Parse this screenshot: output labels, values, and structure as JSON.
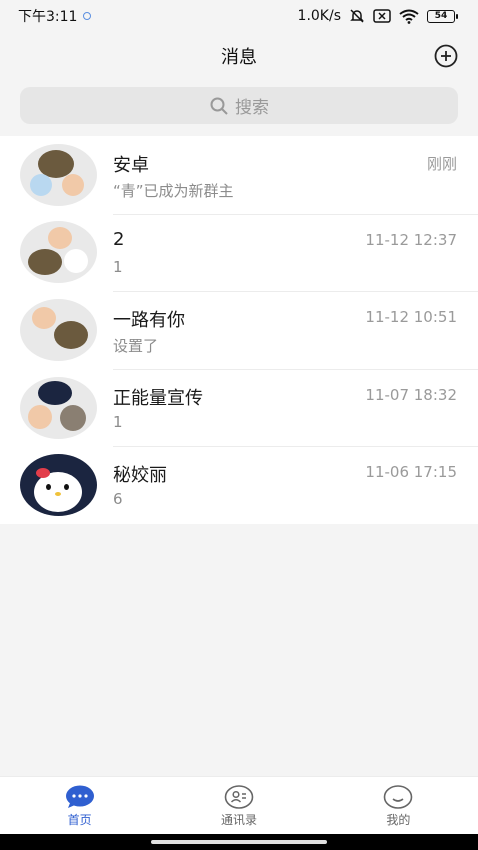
{
  "status_bar": {
    "time": "下午3:11",
    "network_speed": "1.0K/s",
    "battery": "54"
  },
  "header": {
    "title": "消息",
    "add_icon": "plus-circle-icon"
  },
  "search": {
    "placeholder": "搜索",
    "icon": "search-icon"
  },
  "conversations": [
    {
      "name": "安卓",
      "preview": "“青”已成为新群主",
      "time": "刚刚"
    },
    {
      "name": "2",
      "preview": "1",
      "time": "11-12 12:37"
    },
    {
      "name": "一路有你",
      "preview": "设置了",
      "time": "11-12 10:51"
    },
    {
      "name": "正能量宣传",
      "preview": "1",
      "time": "11-07 18:32"
    },
    {
      "name": "秘姣丽",
      "preview": "6",
      "time": "11-06 17:15"
    }
  ],
  "tabs": [
    {
      "label": "首页",
      "icon": "chat-bubble-icon",
      "active": true
    },
    {
      "label": "通讯录",
      "icon": "contacts-icon",
      "active": false
    },
    {
      "label": "我的",
      "icon": "smile-icon",
      "active": false
    }
  ],
  "colors": {
    "accent": "#2f5fd0",
    "background": "#f4f4f4"
  }
}
